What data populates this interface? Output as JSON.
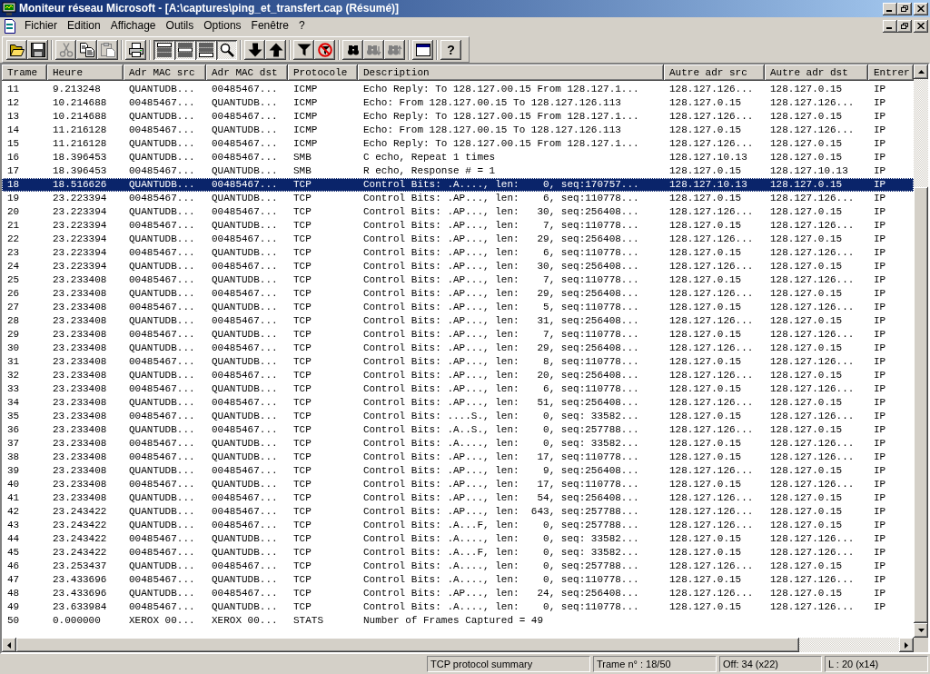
{
  "window": {
    "title": "Moniteur réseau Microsoft - [A:\\captures\\ping_et_transfert.cap (Résumé)]"
  },
  "menu": [
    {
      "label": "Fichier"
    },
    {
      "label": "Edition"
    },
    {
      "label": "Affichage"
    },
    {
      "label": "Outils"
    },
    {
      "label": "Options"
    },
    {
      "label": "Fenêtre"
    },
    {
      "label": "?"
    }
  ],
  "toolbar": {
    "groups": [
      [
        {
          "disabled": false,
          "pressed": false
        },
        {
          "disabled": false,
          "pressed": false
        }
      ],
      [
        {
          "disabled": true,
          "pressed": false
        },
        {
          "disabled": false,
          "pressed": false
        },
        {
          "disabled": true,
          "pressed": false
        }
      ],
      [
        {
          "disabled": false,
          "pressed": false
        }
      ],
      [
        {
          "disabled": false,
          "pressed": true
        },
        {
          "disabled": false,
          "pressed": true
        },
        {
          "disabled": false,
          "pressed": true
        },
        {
          "disabled": false,
          "pressed": true
        }
      ],
      [
        {
          "disabled": false,
          "pressed": false
        },
        {
          "disabled": false,
          "pressed": false
        }
      ],
      [
        {
          "disabled": false,
          "pressed": false
        },
        {
          "disabled": false,
          "pressed": false
        }
      ],
      [
        {
          "disabled": false,
          "pressed": false
        },
        {
          "disabled": true,
          "pressed": false
        },
        {
          "disabled": true,
          "pressed": false
        }
      ],
      [
        {
          "disabled": false,
          "pressed": false
        }
      ],
      [
        {
          "disabled": false,
          "pressed": false,
          "label": "?"
        }
      ]
    ]
  },
  "table": {
    "columns": [
      "Trame",
      "Heure",
      "Adr MAC src",
      "Adr MAC dst",
      "Protocole",
      "Description",
      "Autre adr src",
      "Autre adr dst",
      "Entrer"
    ],
    "rows": [
      {
        "selected": false,
        "cells": [
          "11",
          "9.213248",
          "QUANTUDB...",
          "00485467...",
          "ICMP",
          "Echo Reply: To 128.127.00.15 From 128.127.1...",
          "128.127.126...",
          "128.127.0.15",
          "IP"
        ]
      },
      {
        "selected": false,
        "cells": [
          "12",
          "10.214688",
          "00485467...",
          "QUANTUDB...",
          "ICMP",
          "Echo: From 128.127.00.15 To 128.127.126.113",
          "128.127.0.15",
          "128.127.126...",
          "IP"
        ]
      },
      {
        "selected": false,
        "cells": [
          "13",
          "10.214688",
          "QUANTUDB...",
          "00485467...",
          "ICMP",
          "Echo Reply: To 128.127.00.15 From 128.127.1...",
          "128.127.126...",
          "128.127.0.15",
          "IP"
        ]
      },
      {
        "selected": false,
        "cells": [
          "14",
          "11.216128",
          "00485467...",
          "QUANTUDB...",
          "ICMP",
          "Echo: From 128.127.00.15 To 128.127.126.113",
          "128.127.0.15",
          "128.127.126...",
          "IP"
        ]
      },
      {
        "selected": false,
        "cells": [
          "15",
          "11.216128",
          "QUANTUDB...",
          "00485467...",
          "ICMP",
          "Echo Reply: To 128.127.00.15 From 128.127.1...",
          "128.127.126...",
          "128.127.0.15",
          "IP"
        ]
      },
      {
        "selected": false,
        "cells": [
          "16",
          "18.396453",
          "QUANTUDB...",
          "00485467...",
          "SMB",
          "C echo, Repeat 1 times",
          "128.127.10.13",
          "128.127.0.15",
          "IP"
        ]
      },
      {
        "selected": false,
        "cells": [
          "17",
          "18.396453",
          "00485467...",
          "QUANTUDB...",
          "SMB",
          "R echo, Response # = 1",
          "128.127.0.15",
          "128.127.10.13",
          "IP"
        ]
      },
      {
        "selected": true,
        "cells": [
          "18",
          "18.516626",
          "QUANTUDB...",
          "00485467...",
          "TCP",
          "Control Bits: .A...., len:    0, seq:170757...",
          "128.127.10.13",
          "128.127.0.15",
          "IP"
        ]
      },
      {
        "selected": false,
        "cells": [
          "19",
          "23.223394",
          "00485467...",
          "QUANTUDB...",
          "TCP",
          "Control Bits: .AP..., len:    6, seq:110778...",
          "128.127.0.15",
          "128.127.126...",
          "IP"
        ]
      },
      {
        "selected": false,
        "cells": [
          "20",
          "23.223394",
          "QUANTUDB...",
          "00485467...",
          "TCP",
          "Control Bits: .AP..., len:   30, seq:256408...",
          "128.127.126...",
          "128.127.0.15",
          "IP"
        ]
      },
      {
        "selected": false,
        "cells": [
          "21",
          "23.223394",
          "00485467...",
          "QUANTUDB...",
          "TCP",
          "Control Bits: .AP..., len:    7, seq:110778...",
          "128.127.0.15",
          "128.127.126...",
          "IP"
        ]
      },
      {
        "selected": false,
        "cells": [
          "22",
          "23.223394",
          "QUANTUDB...",
          "00485467...",
          "TCP",
          "Control Bits: .AP..., len:   29, seq:256408...",
          "128.127.126...",
          "128.127.0.15",
          "IP"
        ]
      },
      {
        "selected": false,
        "cells": [
          "23",
          "23.223394",
          "00485467...",
          "QUANTUDB...",
          "TCP",
          "Control Bits: .AP..., len:    6, seq:110778...",
          "128.127.0.15",
          "128.127.126...",
          "IP"
        ]
      },
      {
        "selected": false,
        "cells": [
          "24",
          "23.223394",
          "QUANTUDB...",
          "00485467...",
          "TCP",
          "Control Bits: .AP..., len:   30, seq:256408...",
          "128.127.126...",
          "128.127.0.15",
          "IP"
        ]
      },
      {
        "selected": false,
        "cells": [
          "25",
          "23.233408",
          "00485467...",
          "QUANTUDB...",
          "TCP",
          "Control Bits: .AP..., len:    7, seq:110778...",
          "128.127.0.15",
          "128.127.126...",
          "IP"
        ]
      },
      {
        "selected": false,
        "cells": [
          "26",
          "23.233408",
          "QUANTUDB...",
          "00485467...",
          "TCP",
          "Control Bits: .AP..., len:   29, seq:256408...",
          "128.127.126...",
          "128.127.0.15",
          "IP"
        ]
      },
      {
        "selected": false,
        "cells": [
          "27",
          "23.233408",
          "00485467...",
          "QUANTUDB...",
          "TCP",
          "Control Bits: .AP..., len:    5, seq:110778...",
          "128.127.0.15",
          "128.127.126...",
          "IP"
        ]
      },
      {
        "selected": false,
        "cells": [
          "28",
          "23.233408",
          "QUANTUDB...",
          "00485467...",
          "TCP",
          "Control Bits: .AP..., len:   31, seq:256408...",
          "128.127.126...",
          "128.127.0.15",
          "IP"
        ]
      },
      {
        "selected": false,
        "cells": [
          "29",
          "23.233408",
          "00485467...",
          "QUANTUDB...",
          "TCP",
          "Control Bits: .AP..., len:    7, seq:110778...",
          "128.127.0.15",
          "128.127.126...",
          "IP"
        ]
      },
      {
        "selected": false,
        "cells": [
          "30",
          "23.233408",
          "QUANTUDB...",
          "00485467...",
          "TCP",
          "Control Bits: .AP..., len:   29, seq:256408...",
          "128.127.126...",
          "128.127.0.15",
          "IP"
        ]
      },
      {
        "selected": false,
        "cells": [
          "31",
          "23.233408",
          "00485467...",
          "QUANTUDB...",
          "TCP",
          "Control Bits: .AP..., len:    8, seq:110778...",
          "128.127.0.15",
          "128.127.126...",
          "IP"
        ]
      },
      {
        "selected": false,
        "cells": [
          "32",
          "23.233408",
          "QUANTUDB...",
          "00485467...",
          "TCP",
          "Control Bits: .AP..., len:   20, seq:256408...",
          "128.127.126...",
          "128.127.0.15",
          "IP"
        ]
      },
      {
        "selected": false,
        "cells": [
          "33",
          "23.233408",
          "00485467...",
          "QUANTUDB...",
          "TCP",
          "Control Bits: .AP..., len:    6, seq:110778...",
          "128.127.0.15",
          "128.127.126...",
          "IP"
        ]
      },
      {
        "selected": false,
        "cells": [
          "34",
          "23.233408",
          "QUANTUDB...",
          "00485467...",
          "TCP",
          "Control Bits: .AP..., len:   51, seq:256408...",
          "128.127.126...",
          "128.127.0.15",
          "IP"
        ]
      },
      {
        "selected": false,
        "cells": [
          "35",
          "23.233408",
          "00485467...",
          "QUANTUDB...",
          "TCP",
          "Control Bits: ....S., len:    0, seq: 33582...",
          "128.127.0.15",
          "128.127.126...",
          "IP"
        ]
      },
      {
        "selected": false,
        "cells": [
          "36",
          "23.233408",
          "QUANTUDB...",
          "00485467...",
          "TCP",
          "Control Bits: .A..S., len:    0, seq:257788...",
          "128.127.126...",
          "128.127.0.15",
          "IP"
        ]
      },
      {
        "selected": false,
        "cells": [
          "37",
          "23.233408",
          "00485467...",
          "QUANTUDB...",
          "TCP",
          "Control Bits: .A...., len:    0, seq: 33582...",
          "128.127.0.15",
          "128.127.126...",
          "IP"
        ]
      },
      {
        "selected": false,
        "cells": [
          "38",
          "23.233408",
          "00485467...",
          "QUANTUDB...",
          "TCP",
          "Control Bits: .AP..., len:   17, seq:110778...",
          "128.127.0.15",
          "128.127.126...",
          "IP"
        ]
      },
      {
        "selected": false,
        "cells": [
          "39",
          "23.233408",
          "QUANTUDB...",
          "00485467...",
          "TCP",
          "Control Bits: .AP..., len:    9, seq:256408...",
          "128.127.126...",
          "128.127.0.15",
          "IP"
        ]
      },
      {
        "selected": false,
        "cells": [
          "40",
          "23.233408",
          "00485467...",
          "QUANTUDB...",
          "TCP",
          "Control Bits: .AP..., len:   17, seq:110778...",
          "128.127.0.15",
          "128.127.126...",
          "IP"
        ]
      },
      {
        "selected": false,
        "cells": [
          "41",
          "23.233408",
          "QUANTUDB...",
          "00485467...",
          "TCP",
          "Control Bits: .AP..., len:   54, seq:256408...",
          "128.127.126...",
          "128.127.0.15",
          "IP"
        ]
      },
      {
        "selected": false,
        "cells": [
          "42",
          "23.243422",
          "QUANTUDB...",
          "00485467...",
          "TCP",
          "Control Bits: .AP..., len:  643, seq:257788...",
          "128.127.126...",
          "128.127.0.15",
          "IP"
        ]
      },
      {
        "selected": false,
        "cells": [
          "43",
          "23.243422",
          "QUANTUDB...",
          "00485467...",
          "TCP",
          "Control Bits: .A...F, len:    0, seq:257788...",
          "128.127.126...",
          "128.127.0.15",
          "IP"
        ]
      },
      {
        "selected": false,
        "cells": [
          "44",
          "23.243422",
          "00485467...",
          "QUANTUDB...",
          "TCP",
          "Control Bits: .A...., len:    0, seq: 33582...",
          "128.127.0.15",
          "128.127.126...",
          "IP"
        ]
      },
      {
        "selected": false,
        "cells": [
          "45",
          "23.243422",
          "00485467...",
          "QUANTUDB...",
          "TCP",
          "Control Bits: .A...F, len:    0, seq: 33582...",
          "128.127.0.15",
          "128.127.126...",
          "IP"
        ]
      },
      {
        "selected": false,
        "cells": [
          "46",
          "23.253437",
          "QUANTUDB...",
          "00485467...",
          "TCP",
          "Control Bits: .A...., len:    0, seq:257788...",
          "128.127.126...",
          "128.127.0.15",
          "IP"
        ]
      },
      {
        "selected": false,
        "cells": [
          "47",
          "23.433696",
          "00485467...",
          "QUANTUDB...",
          "TCP",
          "Control Bits: .A...., len:    0, seq:110778...",
          "128.127.0.15",
          "128.127.126...",
          "IP"
        ]
      },
      {
        "selected": false,
        "cells": [
          "48",
          "23.433696",
          "QUANTUDB...",
          "00485467...",
          "TCP",
          "Control Bits: .AP..., len:   24, seq:256408...",
          "128.127.126...",
          "128.127.0.15",
          "IP"
        ]
      },
      {
        "selected": false,
        "cells": [
          "49",
          "23.633984",
          "00485467...",
          "QUANTUDB...",
          "TCP",
          "Control Bits: .A...., len:    0, seq:110778...",
          "128.127.0.15",
          "128.127.126...",
          "IP"
        ]
      },
      {
        "selected": false,
        "cells": [
          "50",
          "0.000000",
          "XEROX 00...",
          "XEROX 00...",
          "STATS",
          "Number of Frames Captured = 49"
        ]
      }
    ]
  },
  "status_bar": {
    "panels": [
      "TCP protocol summary",
      "Trame n° : 18/50",
      "Off: 34 (x22)",
      "L : 20 (x14)"
    ]
  }
}
